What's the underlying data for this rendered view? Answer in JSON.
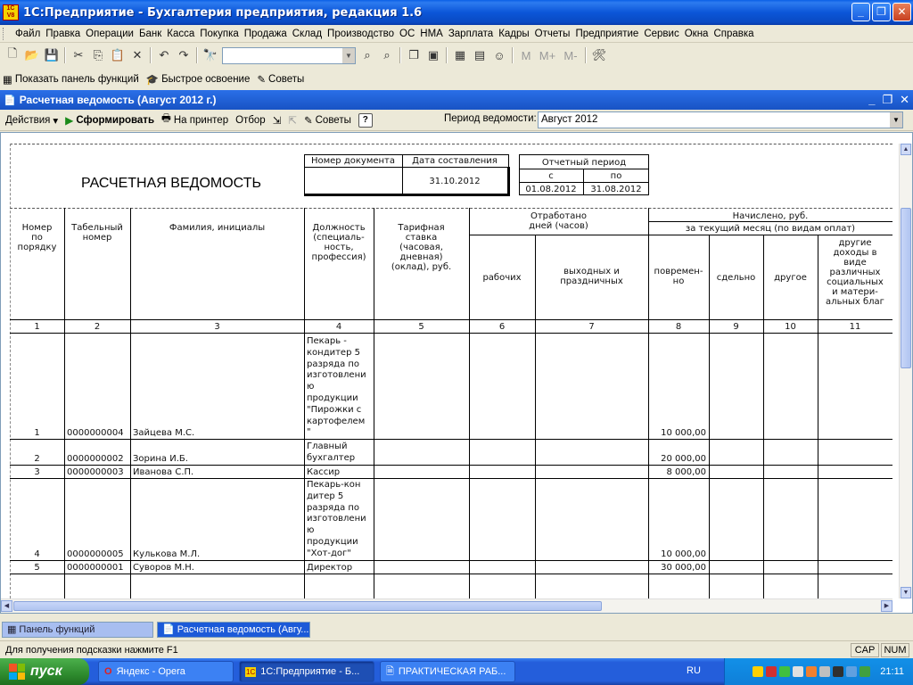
{
  "window": {
    "title": "1С:Предприятие - Бухгалтерия предприятия, редакция 1.6",
    "app_icon": "1C\nV8"
  },
  "menu": [
    "Файл",
    "Правка",
    "Операции",
    "Банк",
    "Касса",
    "Покупка",
    "Продажа",
    "Склад",
    "Производство",
    "ОС",
    "НМА",
    "Зарплата",
    "Кадры",
    "Отчеты",
    "Предприятие",
    "Сервис",
    "Окна",
    "Справка"
  ],
  "toolbar2": {
    "show_panel": "Показать панель функций",
    "quick_start": "Быстрое освоение",
    "tips": "Советы"
  },
  "doc": {
    "title": "Расчетная ведомость (Август 2012 г.)",
    "actions": "Действия",
    "form": "Сформировать",
    "print": "На принтер",
    "filter": "Отбор",
    "tips": "Советы",
    "period_label": "Период ведомости:",
    "period_value": "Август 2012"
  },
  "report": {
    "title": "РАСЧЕТНАЯ ВЕДОМОСТЬ",
    "doc_number_label": "Номер документа",
    "doc_date_label": "Дата составления",
    "doc_date": "31.10.2012",
    "period_label": "Отчетный период",
    "from_label": "с",
    "to_label": "по",
    "from": "01.08.2012",
    "to": "31.08.2012",
    "headers": {
      "num": "Номер\nпо\nпорядку",
      "tab": "Табельный\nномер",
      "name": "Фамилия, инициалы",
      "position": "Должность\n(специаль-\nность,\nпрофессия)",
      "rate": "Тарифная\nставка\n(часовая,\nдневная)\n(оклад), руб.",
      "worked": "Отработано\nдней (часов)",
      "workdays": "рабочих",
      "holidays": "выходных и\nпраздничных",
      "accrued": "Начислено, руб.",
      "current_month": "за текущий месяц (по видам оплат)",
      "time": "повремен-\nно",
      "piece": "сдельно",
      "other": "другое",
      "other_income": "другие\nдоходы в\nвиде\nразличных\nсоциальных\nи матери-\nальных благ"
    },
    "col_numbers": [
      "1",
      "2",
      "3",
      "4",
      "5",
      "6",
      "7",
      "8",
      "9",
      "10",
      "11"
    ],
    "rows": [
      {
        "n": "1",
        "tab": "0000000004",
        "name": "Зайцева М.С.",
        "pos": "Пекарь -\nкондитер 5\nразряда по\nизготовлени\nю\nпродукции\n\"Пирожки с\nкартофелем\n\"",
        "amount": "10 000,00"
      },
      {
        "n": "2",
        "tab": "0000000002",
        "name": "Зорина И.Б.",
        "pos": "Главный\nбухгалтер",
        "amount": "20 000,00"
      },
      {
        "n": "3",
        "tab": "0000000003",
        "name": "Иванова С.П.",
        "pos": "Кассир",
        "amount": "8 000,00"
      },
      {
        "n": "4",
        "tab": "0000000005",
        "name": "Кулькова М.Л.",
        "pos": "Пекарь-кон\nдитер 5\nразряда по\nизготовлени\nю\nпродукции\n\"Хот-дог\"",
        "amount": "10 000,00"
      },
      {
        "n": "5",
        "tab": "0000000001",
        "name": "Суворов М.Н.",
        "pos": "Директор",
        "amount": "30 000,00"
      }
    ]
  },
  "tabs": {
    "panel": "Панель функций",
    "report": "Расчетная ведомость (Авгу..."
  },
  "status": {
    "hint": "Для получения подсказки нажмите F1",
    "cap": "CAP",
    "num": "NUM"
  },
  "taskbar": {
    "start": "пуск",
    "tasks": [
      "Яндекс - Opera",
      "1С:Предприятие - Б...",
      "ПРАКТИЧЕСКАЯ РАБ..."
    ],
    "lang": "RU",
    "clock": "21:11"
  }
}
